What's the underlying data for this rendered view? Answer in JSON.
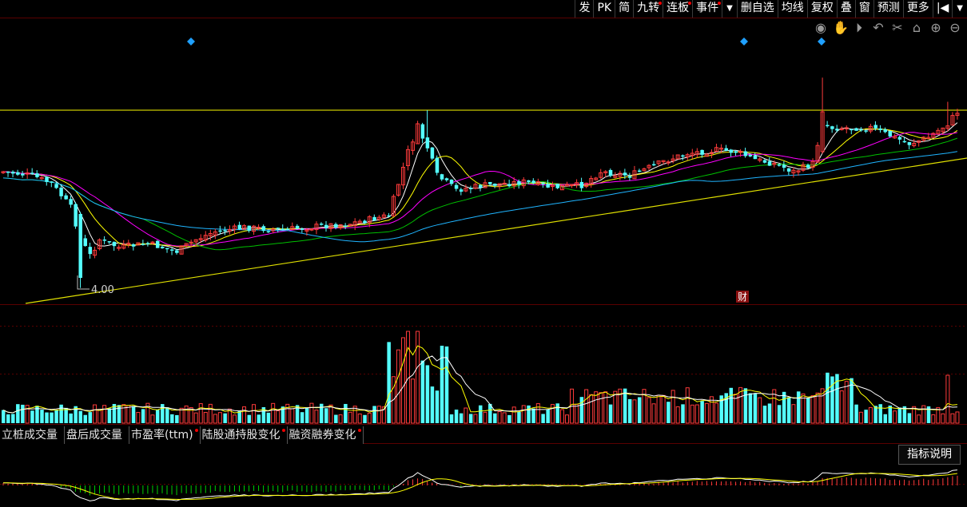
{
  "toolbar": {
    "items": [
      {
        "label": "发",
        "mark": false
      },
      {
        "label": "PK",
        "mark": false
      },
      {
        "label": "简",
        "mark": false
      },
      {
        "label": "九转",
        "mark": true
      },
      {
        "label": "连板",
        "mark": true
      },
      {
        "label": "事件",
        "mark": true
      },
      {
        "label": "▼",
        "mark": false
      },
      {
        "label": "删自选",
        "mark": false
      },
      {
        "label": "均线",
        "mark": false
      },
      {
        "label": "复权",
        "mark": false
      },
      {
        "label": "叠",
        "mark": false
      },
      {
        "label": "窗",
        "mark": false
      },
      {
        "label": "预测",
        "mark": false
      },
      {
        "label": "更多",
        "mark": false
      },
      {
        "label": "|◀",
        "mark": false
      },
      {
        "label": "▼",
        "mark": false
      }
    ]
  },
  "chart_icons": [
    "eye-icon",
    "hand-icon",
    "play-icon",
    "undo-icon",
    "scissors-icon",
    "lock-icon",
    "zoom-in-icon",
    "zoom-out-icon"
  ],
  "main_chart": {
    "low_label": "4.00",
    "finance_marker": "财",
    "diamond_markers": 3
  },
  "tabs": [
    {
      "label": "立桩成交量",
      "dot": false
    },
    {
      "label": "盘后成交量",
      "dot": false
    },
    {
      "label": "市盈率(ttm)",
      "dot": true
    },
    {
      "label": "陆股通持股变化",
      "dot": true
    },
    {
      "label": "融资融券变化",
      "dot": true
    }
  ],
  "help_button": "指标说明",
  "colors": {
    "up": "#ff3b3b",
    "down": "#54ffff",
    "ma5": "#ffffff",
    "ma10": "#ffff00",
    "ma20": "#ff00ff",
    "ma30": "#00c000",
    "ma60": "#1fb4ff",
    "trend": "#e0e000",
    "resistance": "#c8c800"
  }
}
